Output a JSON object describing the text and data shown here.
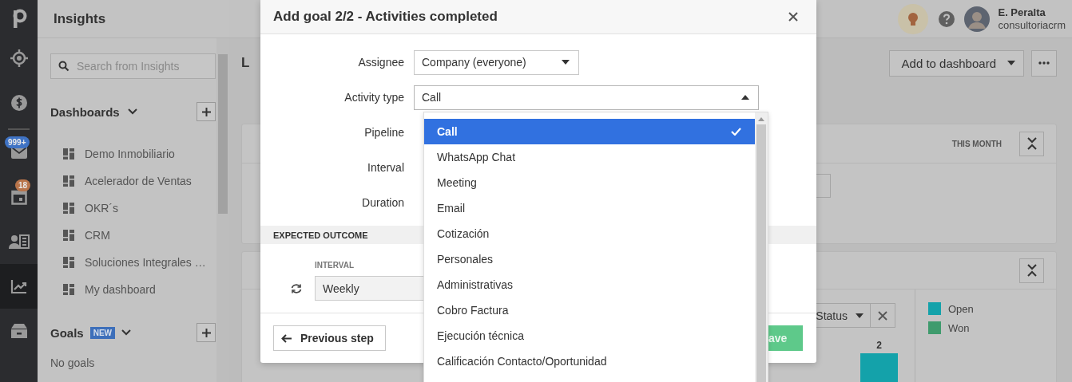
{
  "nav": {
    "items": [
      {
        "selected": false
      },
      {
        "selected": false
      },
      {
        "selected": false
      },
      {
        "selected": false,
        "badge": "999+",
        "color": "#3f73c4"
      },
      {
        "selected": false,
        "badge": "18",
        "color": "#b8744a"
      },
      {
        "selected": false
      },
      {
        "selected": true
      },
      {
        "selected": false
      }
    ]
  },
  "sidebar": {
    "title": "Insights",
    "search": {
      "placeholder": "Search from Insights"
    },
    "dashboards": {
      "title": "Dashboards",
      "items": [
        "Demo Inmobiliario",
        "Acelerador de Ventas",
        "OKR´s",
        "CRM",
        "Soluciones Integrales …",
        "My dashboard"
      ]
    },
    "goals": {
      "title": "Goals",
      "badge": "NEW",
      "empty": "No goals"
    }
  },
  "topbar": {
    "user": {
      "name": "E. Peralta",
      "account": "consultoriacrm"
    }
  },
  "main": {
    "title": "L",
    "actions": [
      "Add to dashboard"
    ],
    "cards": [
      {
        "period": "THIS MONTH"
      },
      {
        "filter": "Status",
        "legend": [
          {
            "label": "Open",
            "color": "#14a2aa"
          },
          {
            "label": "Won",
            "color": "#3f9b6d"
          }
        ],
        "bar_label": "2"
      }
    ]
  },
  "modal": {
    "title": "Add goal 2/2 - Activities completed",
    "fields": [
      {
        "label": "Assignee",
        "value": "Company (everyone)",
        "expanded": false
      },
      {
        "label": "Activity type",
        "value": "Call",
        "expanded": true
      },
      {
        "label": "Pipeline"
      },
      {
        "label": "Interval"
      },
      {
        "label": "Duration"
      }
    ],
    "section": "EXPECTED OUTCOME",
    "interval_label": "INTERVAL",
    "interval_value": "Weekly",
    "back": "Previous step",
    "save": "ave",
    "options": [
      {
        "label": "Call",
        "selected": true
      },
      {
        "label": "WhatsApp Chat",
        "selected": false
      },
      {
        "label": "Meeting",
        "selected": false
      },
      {
        "label": "Email",
        "selected": false
      },
      {
        "label": "Cotización",
        "selected": false
      },
      {
        "label": "Personales",
        "selected": false
      },
      {
        "label": "Administrativas",
        "selected": false
      },
      {
        "label": "Cobro Factura",
        "selected": false
      },
      {
        "label": "Ejecución técnica",
        "selected": false
      },
      {
        "label": "Calificación Contacto/Oportunidad",
        "selected": false
      }
    ]
  }
}
